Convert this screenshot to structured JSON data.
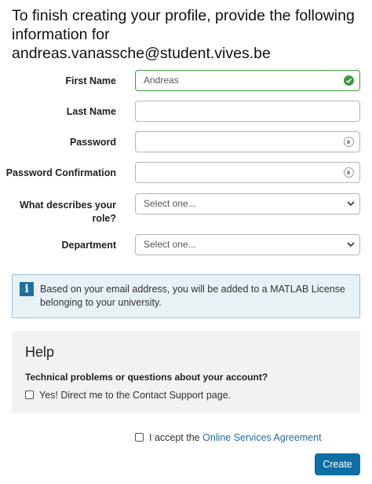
{
  "heading": {
    "line1": "To finish creating your profile, provide the following",
    "line2": "information for",
    "email": "andreas.vanassche@student.vives.be"
  },
  "form": {
    "first_name": {
      "label": "First Name",
      "value": "Andreas",
      "status_icon": "check-circle-icon"
    },
    "last_name": {
      "label": "Last Name",
      "value": ""
    },
    "password": {
      "label": "Password",
      "value": "",
      "icon": "password-manager-icon"
    },
    "password_confirmation": {
      "label": "Password Confirmation",
      "value": "",
      "icon": "password-manager-icon"
    },
    "role": {
      "label_line1": "What describes your",
      "label_line2": "role?",
      "selected": "Select one..."
    },
    "department": {
      "label": "Department",
      "selected": "Select one..."
    }
  },
  "info_box": {
    "icon": "info-icon",
    "icon_glyph": "i",
    "line1": "Based on your email address, you will be added to a MATLAB License",
    "line2": "belonging to your university."
  },
  "help": {
    "title": "Help",
    "question": "Technical problems or questions about your account?",
    "checkbox_label": "Yes! Direct me to the Contact Support page."
  },
  "agreement": {
    "prefix": "I accept the ",
    "link_text": "Online Services Agreement"
  },
  "create_button": "Create",
  "colors": {
    "accent": "#0d6fa3",
    "valid": "#3c9a3c",
    "link": "#1f6f9e",
    "info_bg": "#e8f1f5",
    "info_border": "#9cc0d1"
  }
}
